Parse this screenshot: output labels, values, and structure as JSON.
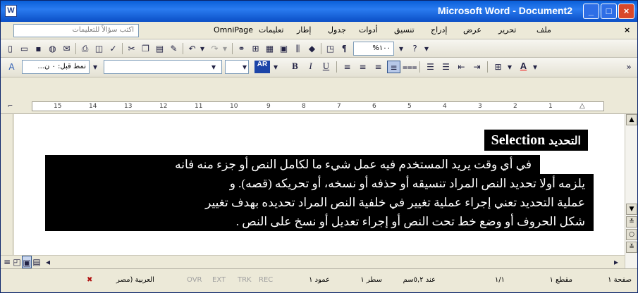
{
  "window": {
    "title": "Microsoft Word - Document2",
    "app_icon": "W"
  },
  "menubar": {
    "help_placeholder": "اكتب سؤالاً للتعليمات",
    "items": [
      "ملف",
      "تحرير",
      "عرض",
      "إدراج",
      "تنسيق",
      "أدوات",
      "جدول",
      "إطار",
      "تعليمات",
      "OmniPage"
    ],
    "close_doc": "×"
  },
  "format": {
    "style": "نمط قبل: ٠ ن...",
    "zoom": "١٠٠%",
    "ar_label": "AR",
    "bold": "B",
    "italic": "I",
    "underline": "U",
    "font_color_letter": "A"
  },
  "ruler": {
    "labels": [
      "15",
      "14",
      "13",
      "12",
      "11",
      "10",
      "9",
      "8",
      "7",
      "6",
      "5",
      "4",
      "3",
      "2",
      "1"
    ]
  },
  "document": {
    "heading_ar": "التحديد",
    "heading_en": "Selection",
    "lines": [
      "في أي وقت يريد المستخدم فيه عمل شيء ما لكامل النص أو جزء منه فانه",
      "يلزمه أولا تحديد النص المراد تنسيقه أو حذفه أو نسخه، أو تحريكه (قصه). و",
      "عملية التحديد تعني إجراء عملية تغيير في خلفية النص المراد تحديده بهدف تغيير",
      "شكل الحروف أو وضع خط تحت النص أو إجراء تعديل أو نسخ على النص ."
    ]
  },
  "statusbar": {
    "page": "صفحة ١",
    "section": "مقطع ١",
    "pages": "١/١",
    "at": "عند ٥,٢سم",
    "ln": "سطر ١",
    "col": "عمود ١",
    "rec": "REC",
    "trk": "TRK",
    "ext": "EXT",
    "ovr": "OVR",
    "language": "العربية (مصر"
  }
}
